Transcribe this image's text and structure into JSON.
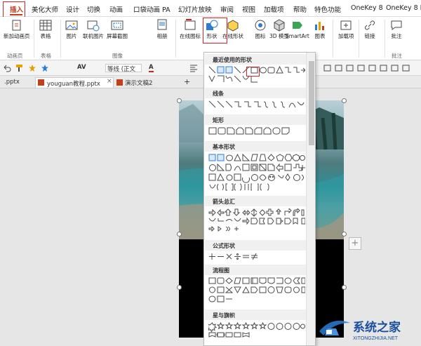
{
  "tabs": [
    {
      "label": "插入",
      "active": true
    },
    {
      "label": "美化大师"
    },
    {
      "label": "设计"
    },
    {
      "label": "切换"
    },
    {
      "label": "动画"
    },
    {
      "label": "口袋动画 PA"
    },
    {
      "label": "幻灯片放映"
    },
    {
      "label": "审阅"
    },
    {
      "label": "视图"
    },
    {
      "label": "加载项"
    },
    {
      "label": "帮助"
    },
    {
      "label": "特色功能"
    },
    {
      "label": "OneKey 8"
    },
    {
      "label": "OneKey 8 B"
    }
  ],
  "ribbon": {
    "new_anim_label": "新加动画页",
    "table_label": "表格",
    "picture_label": "图片",
    "online_pic_label": "联机图片",
    "screenshot_label": "屏幕截图",
    "album_label": "相册",
    "online_icons_label": "在线图标",
    "shapes_label": "形状",
    "online_shapes_label": "在线形状",
    "icons_label": "图标",
    "3d_label": "3D 模型",
    "smartart_label": "SmartArt",
    "chart_label": "图表",
    "addin_label": "加载项",
    "link_label": "链接",
    "comment_label": "批注",
    "groups": {
      "anim": "动画页",
      "tables": "表格",
      "images": "图像",
      "comments": "批注"
    }
  },
  "format_bar": {
    "font_name": "等线 (正文",
    "font_color_letter": "A"
  },
  "file_tabs": [
    {
      "label": ".pptx"
    },
    {
      "label": "youguan教程.pptx"
    },
    {
      "label": "演示文稿2"
    }
  ],
  "file_tab_close": "×",
  "new_tab": "+",
  "plus_label": "+",
  "dropdown": {
    "sections": [
      {
        "title": "最近使用的形状"
      },
      {
        "title": "线条"
      },
      {
        "title": "矩形"
      },
      {
        "title": "基本形状"
      },
      {
        "title": "箭头总汇"
      },
      {
        "title": "公式形状"
      },
      {
        "title": "流程图"
      },
      {
        "title": "星与旗帜"
      }
    ]
  },
  "watermark": {
    "title": "系统之家",
    "url": "XITONGZHIJIA.NET"
  },
  "colors": {
    "accent": "#c43e1c",
    "highlight": "#e02020",
    "shape_stroke": "#4a4a4a"
  }
}
